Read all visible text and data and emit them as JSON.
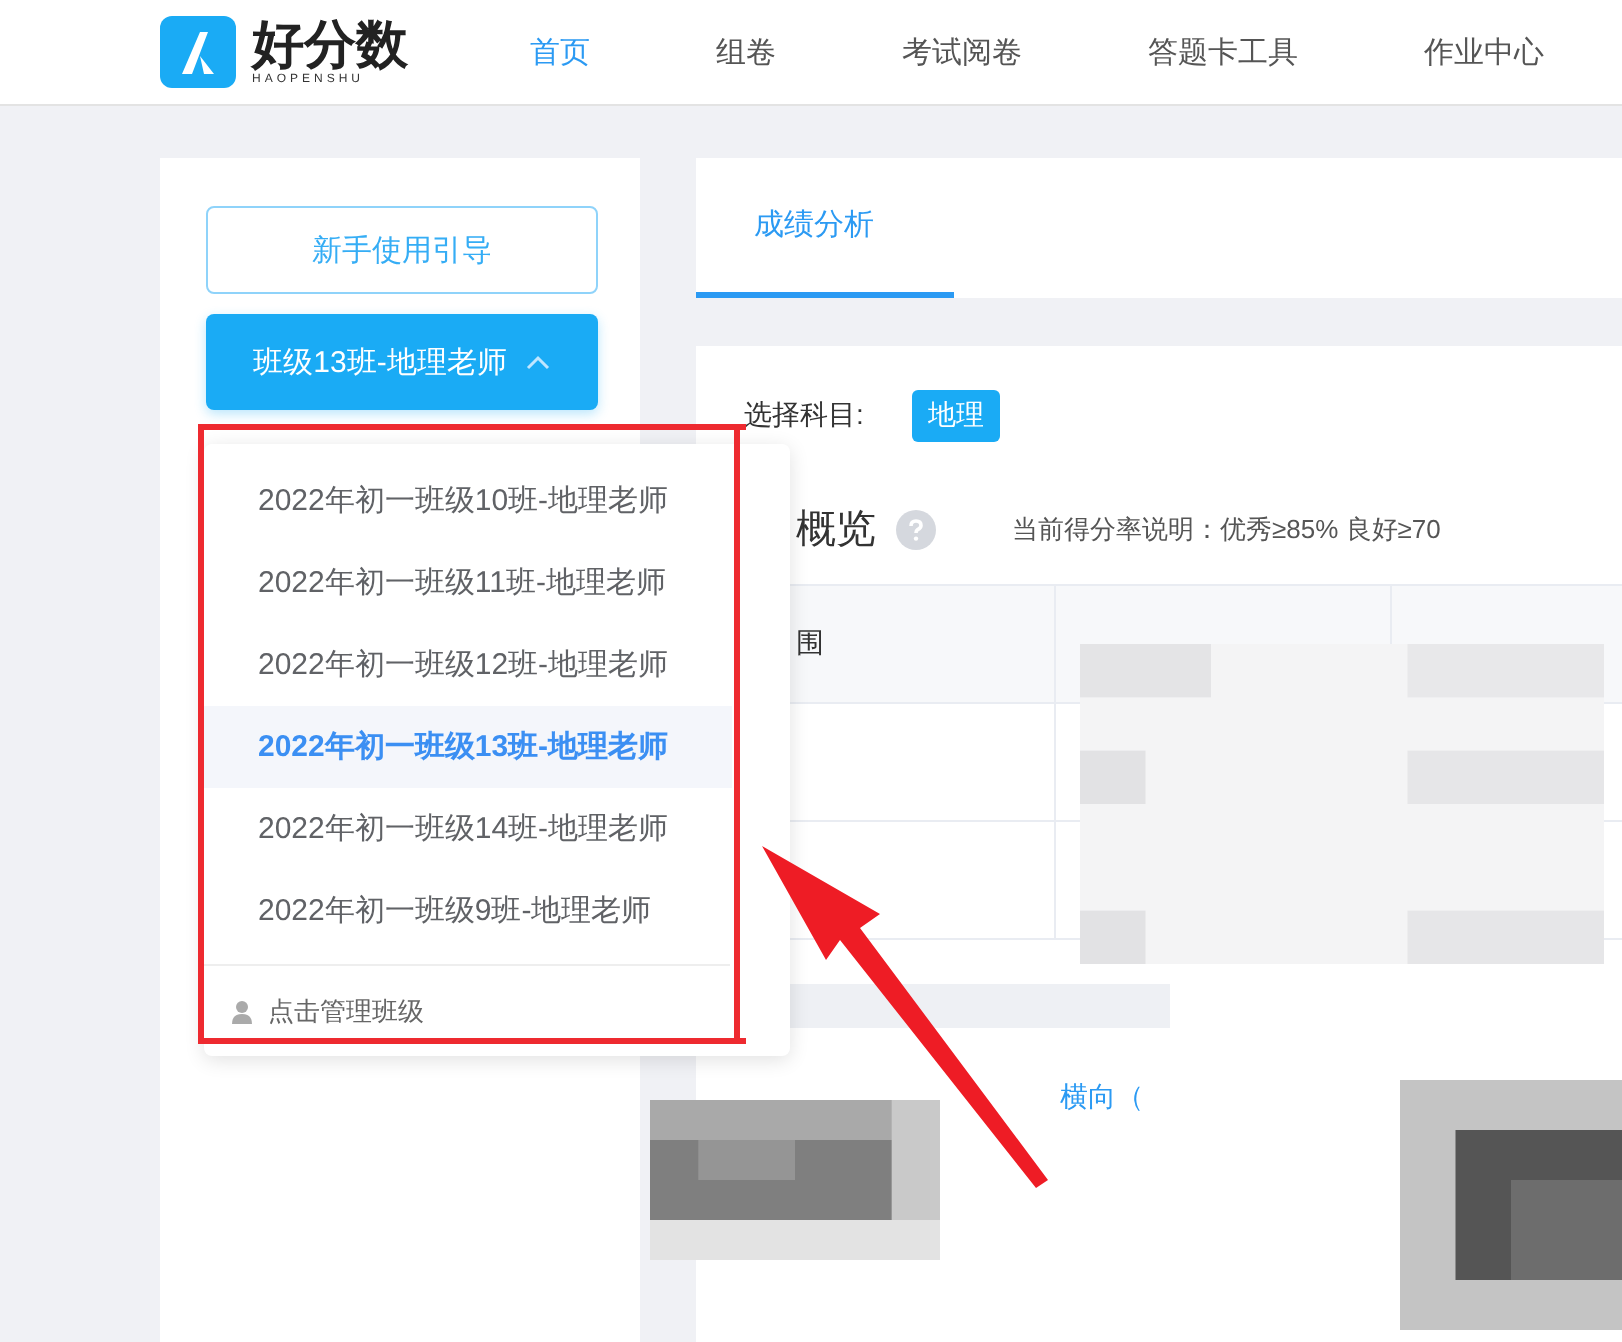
{
  "header": {
    "logo": {
      "name": "好分数",
      "subtitle": "HAOPENSHU"
    },
    "nav": [
      {
        "label": "首页",
        "selected": true
      },
      {
        "label": "组卷",
        "selected": false
      },
      {
        "label": "考试阅卷",
        "selected": false
      },
      {
        "label": "答题卡工具",
        "selected": false
      },
      {
        "label": "作业中心",
        "selected": false
      }
    ]
  },
  "sidebar": {
    "guide_button": "新手使用引导",
    "class_select": {
      "label": "班级13班-地理老师",
      "expanded": true
    },
    "options": [
      {
        "label": "2022年初一班级10班-地理老师",
        "selected": false
      },
      {
        "label": "2022年初一班级11班-地理老师",
        "selected": false
      },
      {
        "label": "2022年初一班级12班-地理老师",
        "selected": false
      },
      {
        "label": "2022年初一班级13班-地理老师",
        "selected": true
      },
      {
        "label": "2022年初一班级14班-地理老师",
        "selected": false
      },
      {
        "label": "2022年初一班级9班-地理老师",
        "selected": false
      }
    ],
    "manage_link": "点击管理班级"
  },
  "main": {
    "tabs": [
      {
        "label": "成绩分析",
        "selected": true
      }
    ],
    "subject_label": "选择科目:",
    "subjects": [
      {
        "label": "地理",
        "selected": true
      }
    ],
    "overview": {
      "title": "概览",
      "note": "当前得分率说明：优秀≥85%  良好≥70"
    },
    "table": {
      "rows": [
        {
          "column_1": "围"
        },
        {
          "column_1": ""
        },
        {
          "column_1": ""
        }
      ]
    },
    "link": "横向（"
  }
}
